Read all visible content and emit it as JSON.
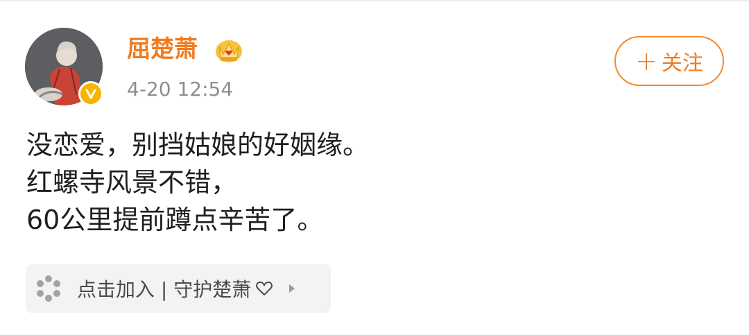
{
  "post": {
    "username": "屈楚萧",
    "timestamp": "4-20 12:54",
    "follow_label": "关注",
    "follow_plus": "+",
    "content_lines": [
      "没恋爱，别挡姑娘的好姻缘。",
      "红螺寺风景不错，",
      "60公里提前蹲点辛苦了。"
    ],
    "topic": {
      "label": "点击加入 | 守护楚萧",
      "heart_icon": "heart-outline-icon",
      "chevron_icon": "chevron-right-icon"
    },
    "icons": {
      "avatar": "user-avatar",
      "verified": "verified-badge-icon",
      "crown": "crown-icon",
      "topic": "fan-group-icon"
    }
  },
  "colors": {
    "username": "#f07c20",
    "follow_border": "#f08a2c",
    "verified_badge": "#f7b500",
    "timestamp": "#8d8d8d",
    "body_text": "#1f1f1f",
    "topic_bg": "#f3f3f3"
  }
}
